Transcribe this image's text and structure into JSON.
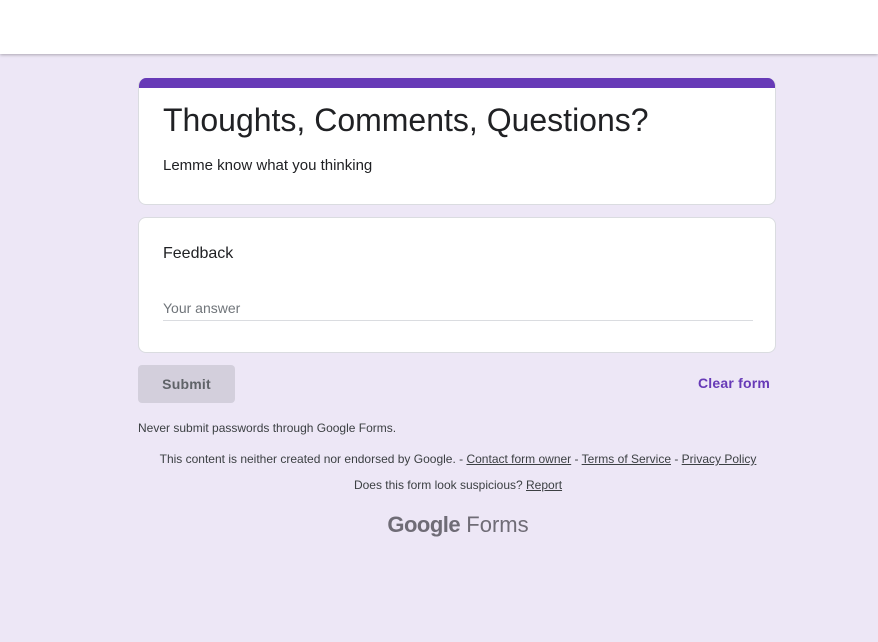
{
  "form": {
    "title": "Thoughts, Comments, Questions?",
    "description": "Lemme know what you thinking",
    "accent_color": "#673ab7",
    "background_color": "#ede7f6"
  },
  "question": {
    "title": "Feedback",
    "placeholder": "Your answer",
    "value": ""
  },
  "actions": {
    "submit_label": "Submit",
    "clear_label": "Clear form"
  },
  "footer": {
    "warning": "Never submit passwords through Google Forms.",
    "disclaimer_prefix": "This content is neither created nor endorsed by Google. - ",
    "contact_link": "Contact form owner",
    "sep1": " - ",
    "terms_link": "Terms of Service",
    "sep2": " - ",
    "privacy_link": "Privacy Policy",
    "suspicious_prefix": "Does this form look suspicious? ",
    "report_link": "Report",
    "brand_google": "Google",
    "brand_forms": " Forms"
  }
}
